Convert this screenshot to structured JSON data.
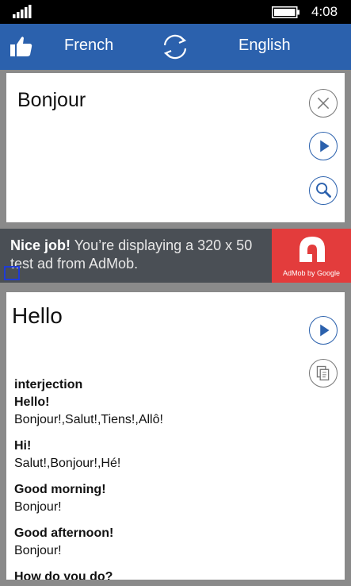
{
  "status_bar": {
    "time": "4:08"
  },
  "top_bar": {
    "source_language": "French",
    "target_language": "English"
  },
  "input": {
    "text": "Bonjour"
  },
  "ad": {
    "headline": "Nice job!",
    "body": "You’re displaying a 320 x 50 test ad from AdMob.",
    "logo_caption": "AdMob by Google",
    "accent_color": "#e33c3c"
  },
  "output": {
    "text": "Hello",
    "part_of_speech": "interjection",
    "entries": [
      {
        "term": "Hello!",
        "translations": "Bonjour!,Salut!,Tiens!,Allô!"
      },
      {
        "term": "Hi!",
        "translations": "Salut!,Bonjour!,Hé!"
      },
      {
        "term": "Good morning!",
        "translations": "Bonjour!"
      },
      {
        "term": "Good afternoon!",
        "translations": "Bonjour!"
      },
      {
        "term": "How do you do?",
        "translations": ""
      }
    ]
  },
  "colors": {
    "brand": "#2b61ad",
    "background": "#8a8a8a"
  },
  "icons": [
    "signal-icon",
    "battery-icon",
    "thumbs-up-icon",
    "swap-languages-icon",
    "clear-icon",
    "play-icon",
    "search-icon",
    "copy-icon",
    "admob-logo-icon",
    "ad-choices-icon"
  ]
}
